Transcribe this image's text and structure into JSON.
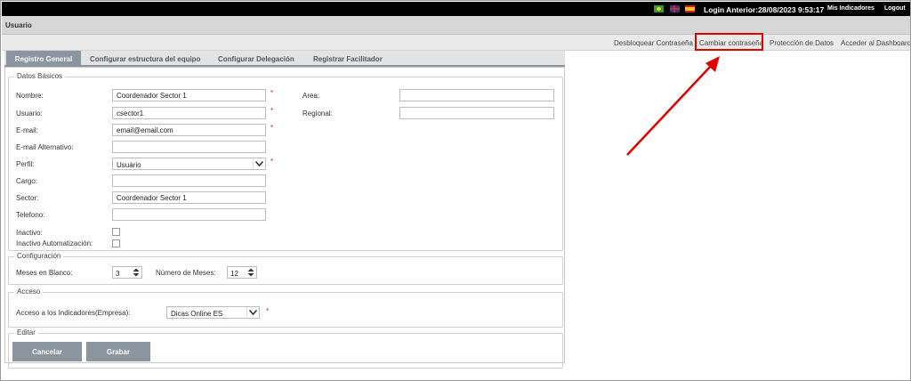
{
  "topbar": {
    "login_text": "Login Anterior:28/08/2023 9:53:17",
    "indicadores": "Mis Indicadores",
    "logout": "Logout",
    "flags": [
      "brazil-flag-icon",
      "uk-flag-icon",
      "spain-flag-icon"
    ]
  },
  "title": "Usuario",
  "actions": [
    "Desbloquear Contraseña",
    "Cambiar contraseña",
    "Protección de Datos",
    "Acceder al Dashboard"
  ],
  "tabs": [
    "Registro General",
    "Configurar estructura del equipo",
    "Configurar Delegación",
    "Registrar Facilitador"
  ],
  "datos_basicos": {
    "legend": "Datos Básicos",
    "nombre": {
      "label": "Nombre:",
      "value": "Coordenador Sector 1"
    },
    "usuario": {
      "label": "Usuario:",
      "value": "csector1"
    },
    "email": {
      "label": "E-mail:",
      "value": "email@email.com"
    },
    "email_alt": {
      "label": "E-mail Alternativo:",
      "value": ""
    },
    "perfil": {
      "label": "Perfil:",
      "value": "Usuário"
    },
    "cargo": {
      "label": "Cargo:",
      "value": ""
    },
    "sector": {
      "label": "Sector:",
      "value": "Coordenador Sector 1"
    },
    "telefono": {
      "label": "Telefono:",
      "value": ""
    },
    "inactivo": {
      "label": "Inactivo:"
    },
    "inactivo_auto": {
      "label": "Inactivo Automatización:"
    },
    "area": {
      "label": "Area:",
      "value": ""
    },
    "regional": {
      "label": "Regional:",
      "value": ""
    },
    "required_mark": "*"
  },
  "configuracion": {
    "legend": "Configuración",
    "meses_blanco": {
      "label": "Meses en Blanco:",
      "value": "3"
    },
    "numero_meses": {
      "label": "Número de Meses:",
      "value": "12"
    }
  },
  "acceso": {
    "legend": "Acceso",
    "indicadores": {
      "label": "Acceso a los Indicadores(Empresa):",
      "value": "Dicas Online ES"
    }
  },
  "editar": {
    "legend": "Editar",
    "cancel": "Cancelar",
    "save": "Grabar"
  },
  "colors": {
    "highlight": "#e00000",
    "tab_active": "#8b95a0"
  }
}
